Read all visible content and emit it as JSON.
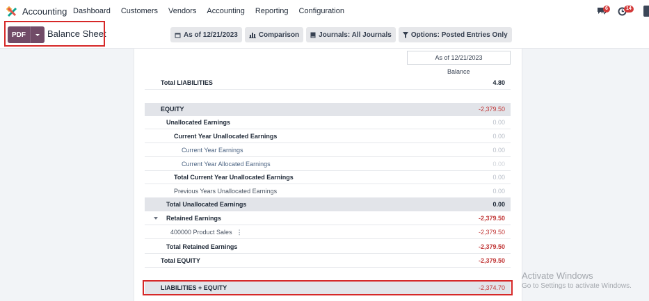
{
  "navbar": {
    "app_name": "Accounting",
    "menu": [
      "Dashboard",
      "Customers",
      "Vendors",
      "Accounting",
      "Reporting",
      "Configuration"
    ],
    "chat_count": "6",
    "activity_count": "14"
  },
  "control": {
    "pdf_label": "PDF",
    "title": "Balance Sheet",
    "filters": {
      "date": "As of 12/21/2023",
      "comparison": "Comparison",
      "journals": "Journals: All Journals",
      "options": "Options: Posted Entries Only"
    }
  },
  "report": {
    "column_header": "As of 12/21/2023",
    "balance_label": "Balance",
    "rows": [
      {
        "label": "Total LIABILITIES",
        "value": "4.80"
      },
      {
        "label": "EQUITY",
        "value": "-2,379.50"
      },
      {
        "label": "Unallocated Earnings",
        "value": "0.00"
      },
      {
        "label": "Current Year Unallocated Earnings",
        "value": "0.00"
      },
      {
        "label": "Current Year Earnings",
        "value": "0.00"
      },
      {
        "label": "Current Year Allocated Earnings",
        "value": "0.00"
      },
      {
        "label": "Total Current Year Unallocated Earnings",
        "value": "0.00"
      },
      {
        "label": "Previous Years Unallocated Earnings",
        "value": "0.00"
      },
      {
        "label": "Total Unallocated Earnings",
        "value": "0.00"
      },
      {
        "label": "Retained Earnings",
        "value": "-2,379.50"
      },
      {
        "label": "400000 Product Sales",
        "value": "-2,379.50"
      },
      {
        "label": "Total Retained Earnings",
        "value": "-2,379.50"
      },
      {
        "label": "Total EQUITY",
        "value": "-2,379.50"
      },
      {
        "label": "LIABILITIES + EQUITY",
        "value": "-2,374.70"
      }
    ]
  },
  "watermark": {
    "line1": "Activate Windows",
    "line2": "Go to Settings to activate Windows."
  }
}
